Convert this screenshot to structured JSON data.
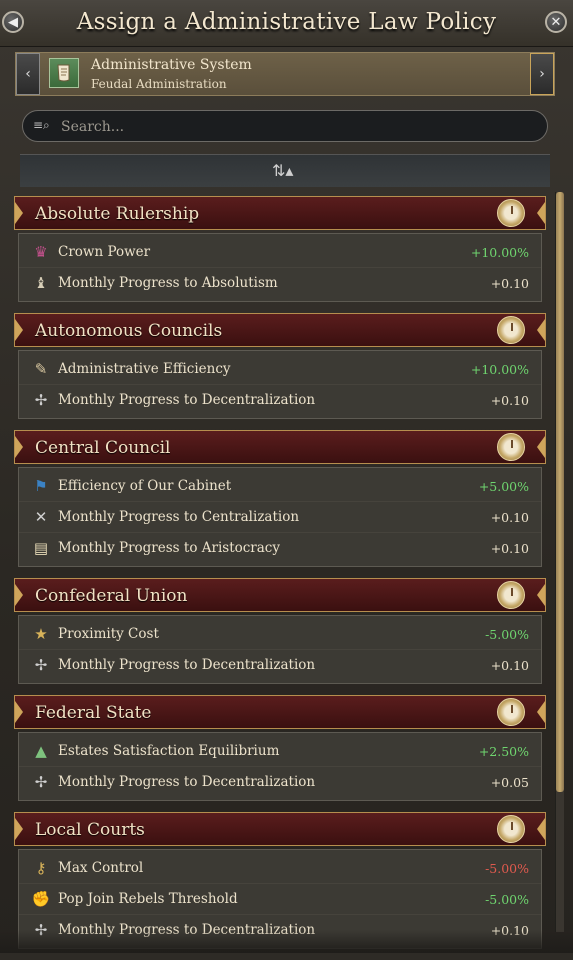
{
  "header": {
    "title": "Assign a Administrative Law Policy"
  },
  "selector": {
    "title": "Administrative System",
    "subtitle": "Feudal Administration",
    "prev_arrow": "‹",
    "next_arrow": "›"
  },
  "search": {
    "placeholder": "Search..."
  },
  "groups": [
    {
      "title": "Absolute Rulership",
      "rows": [
        {
          "icon": "crown-power-icon",
          "label": "Crown Power",
          "value": "+10.00%",
          "tone": "pos"
        },
        {
          "icon": "absolutism-icon",
          "label": "Monthly Progress to Absolutism",
          "value": "+0.10",
          "tone": "neutral"
        }
      ]
    },
    {
      "title": "Autonomous Councils",
      "rows": [
        {
          "icon": "scroll-icon",
          "label": "Administrative Efficiency",
          "value": "+10.00%",
          "tone": "pos"
        },
        {
          "icon": "decentralization-icon",
          "label": "Monthly Progress to Decentralization",
          "value": "+0.10",
          "tone": "neutral"
        }
      ]
    },
    {
      "title": "Central Council",
      "rows": [
        {
          "icon": "cabinet-flag-icon",
          "label": "Efficiency of Our Cabinet",
          "value": "+5.00%",
          "tone": "pos"
        },
        {
          "icon": "centralization-icon",
          "label": "Monthly Progress to Centralization",
          "value": "+0.10",
          "tone": "neutral"
        },
        {
          "icon": "aristocracy-icon",
          "label": "Monthly Progress to Aristocracy",
          "value": "+0.10",
          "tone": "neutral"
        }
      ]
    },
    {
      "title": "Confederal Union",
      "rows": [
        {
          "icon": "proximity-icon",
          "label": "Proximity Cost",
          "value": "-5.00%",
          "tone": "pos"
        },
        {
          "icon": "decentralization-icon",
          "label": "Monthly Progress to Decentralization",
          "value": "+0.10",
          "tone": "neutral"
        }
      ]
    },
    {
      "title": "Federal State",
      "rows": [
        {
          "icon": "estates-icon",
          "label": "Estates Satisfaction Equilibrium",
          "value": "+2.50%",
          "tone": "pos"
        },
        {
          "icon": "decentralization-icon",
          "label": "Monthly Progress to Decentralization",
          "value": "+0.05",
          "tone": "neutral"
        }
      ]
    },
    {
      "title": "Local Courts",
      "rows": [
        {
          "icon": "key-icon",
          "label": "Max Control",
          "value": "-5.00%",
          "tone": "neg"
        },
        {
          "icon": "rebels-icon",
          "label": "Pop Join Rebels Threshold",
          "value": "-5.00%",
          "tone": "pos"
        },
        {
          "icon": "decentralization-icon",
          "label": "Monthly Progress to Decentralization",
          "value": "+0.10",
          "tone": "neutral"
        }
      ]
    }
  ],
  "colors": {
    "positive": "#6fd56f",
    "negative": "#e05a4e",
    "header_bg": "#4a1616",
    "accent_gold": "#cfa55b"
  }
}
